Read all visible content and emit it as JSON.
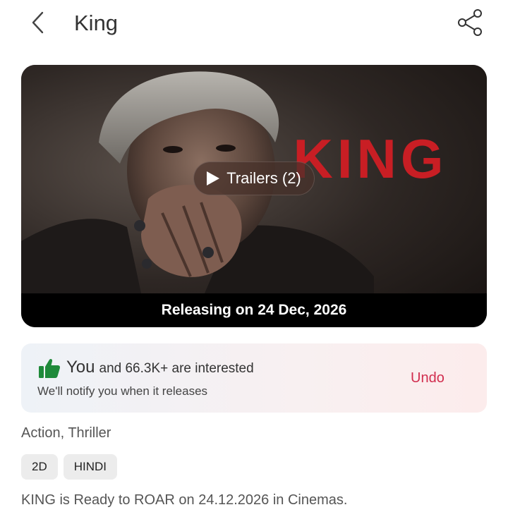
{
  "header": {
    "title": "King",
    "back_icon": "chevron-left-icon",
    "share_icon": "share-icon"
  },
  "hero": {
    "poster_title": "KING",
    "trailer_label": "Trailers (2)",
    "release_text": "Releasing on 24 Dec, 2026"
  },
  "interest": {
    "you": "You",
    "rest": "and 66.3K+  are interested",
    "notify": "We'll notify you when it releases",
    "undo_label": "Undo",
    "accent_color": "#d12d4e",
    "thumb_color": "#1f8a3a"
  },
  "genres": "Action, Thriller",
  "tags": [
    "2D",
    "HINDI"
  ],
  "description": "KING is Ready to ROAR on 24.12.2026 in Cinemas."
}
